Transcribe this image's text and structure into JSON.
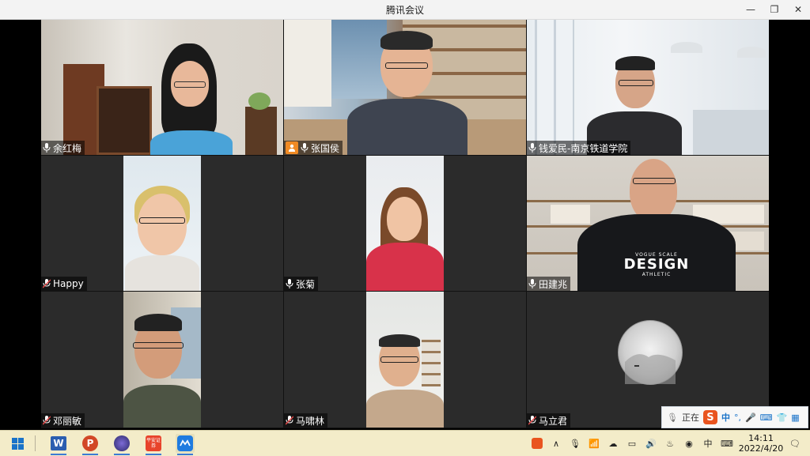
{
  "window": {
    "title": "腾讯会议",
    "minimize": "—",
    "restore": "❐",
    "close": "✕"
  },
  "participants": [
    {
      "name": "余红梅",
      "active": true
    },
    {
      "name": "张国侯"
    },
    {
      "name": "钱爱民-南京铁道学院"
    },
    {
      "name": "Happy"
    },
    {
      "name": "张菊"
    },
    {
      "name": "田建兆"
    },
    {
      "name": "邓丽敏"
    },
    {
      "name": "马啸林"
    },
    {
      "name": "马立君"
    }
  ],
  "shirt_text": {
    "line1": "VOGUE SCALE",
    "line2": "DESIGN",
    "line3": "ATHLETIC"
  },
  "ime": {
    "status": "正在",
    "logo": "S",
    "mode": "中"
  },
  "taskbar": {
    "apps": [
      "word-icon",
      "powerpoint-icon",
      "browser-icon",
      "pingan-icon",
      "tencent-meeting-icon"
    ],
    "pingan_label": "平安证券",
    "time": "14:11",
    "date": "2022/4/20"
  },
  "colors": {
    "active_border": "#3ad36b",
    "taskbar_bg": "#f3ecc9",
    "accent": "#1a73c9"
  }
}
